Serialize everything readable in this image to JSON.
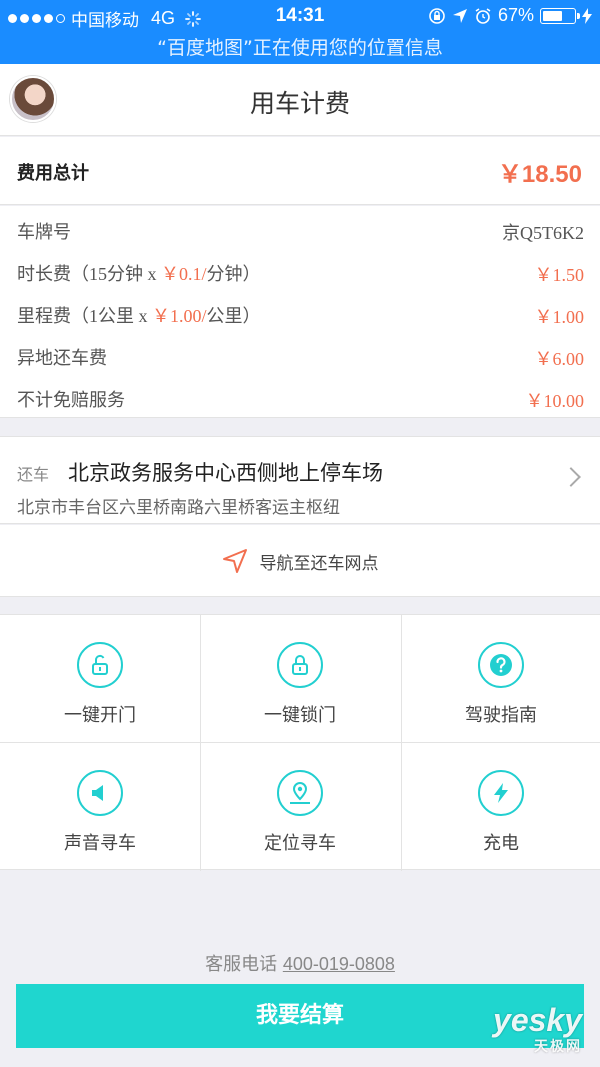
{
  "status_bar": {
    "carrier": "中国移动",
    "network": "4G",
    "time": "14:31",
    "battery": "67%",
    "battery_level": 0.67,
    "location_banner": "“百度地图”正在使用您的位置信息"
  },
  "header": {
    "title": "用车计费"
  },
  "fees": {
    "total_label": "费用总计",
    "total_value": "￥18.50",
    "plate_label": "车牌号",
    "plate_value": "京Q5T6K2",
    "time_fee": {
      "a": "时长费（",
      "b": "15",
      "c": "分钟",
      "d": " x ",
      "e": "￥0.1/",
      "f": "分钟）",
      "value": "￥1.50"
    },
    "mileage_fee": {
      "a": "里程费（",
      "b": "1",
      "c": "公里",
      "d": " x ",
      "e": "￥1.00/",
      "f": "公里）",
      "value": "￥1.00"
    },
    "remote_return": {
      "label": "异地还车费",
      "value": "￥6.00"
    },
    "insurance": {
      "label": "不计免赔服务",
      "value": "￥10.00"
    }
  },
  "return_location": {
    "tag": "还车",
    "name": "北京政务服务中心西侧地上停车场",
    "address": "北京市丰台区六里桥南路六里桥客运主枢纽"
  },
  "navigate_label": "导航至还车网点",
  "actions": [
    {
      "label": "一键开门",
      "icon": "unlock-icon"
    },
    {
      "label": "一键锁门",
      "icon": "lock-icon"
    },
    {
      "label": "驾驶指南",
      "icon": "question-icon"
    },
    {
      "label": "声音寻车",
      "icon": "speaker-icon"
    },
    {
      "label": "定位寻车",
      "icon": "location-pin-icon"
    },
    {
      "label": "充电",
      "icon": "lightning-icon"
    }
  ],
  "footer": {
    "service_label": "客服电话",
    "service_number": "400-019-0808",
    "settle_button": "我要结算"
  },
  "watermark": {
    "brand": "yesky",
    "sub": "天极网"
  },
  "colors": {
    "status_bar": "#1a8cff",
    "accent": "#1fd6cf",
    "price": "#f26f4f",
    "icon": "#22cfd0"
  }
}
